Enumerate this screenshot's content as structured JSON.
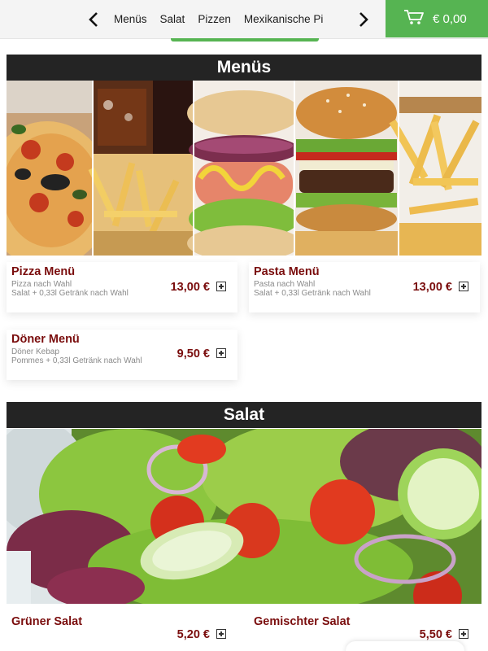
{
  "nav": {
    "categories": [
      "Menüs",
      "Salat",
      "Pizzen",
      "Mexikanische Pi"
    ],
    "prev_icon": "chevron-left-icon",
    "next_icon": "chevron-right-icon",
    "cart_icon": "shopping-cart-icon",
    "cart_total": "€ 0,00",
    "accent_color": "#56b452"
  },
  "sections": {
    "menus": {
      "title": "Menüs",
      "items": [
        {
          "name": "Pizza Menü",
          "desc1": "Pizza nach Wahl",
          "desc2": "Salat + 0,33l Getränk nach Wahl",
          "price": "13,00 €"
        },
        {
          "name": "Pasta Menü",
          "desc1": "Pasta nach Wahl",
          "desc2": "Salat + 0,33l Getränk nach Wahl",
          "price": "13,00 €"
        },
        {
          "name": "Döner Menü",
          "desc1": "Döner Kebap",
          "desc2": "Pommes + 0,33l Getränk nach Wahl",
          "price": "9,50 €"
        }
      ]
    },
    "salat": {
      "title": "Salat",
      "items": [
        {
          "name": "Grüner Salat",
          "price": "5,20 €"
        },
        {
          "name": "Gemischter Salat",
          "price": "5,50 €"
        }
      ]
    }
  },
  "colors": {
    "header_bg": "#242424",
    "price": "#7a0d0d"
  }
}
